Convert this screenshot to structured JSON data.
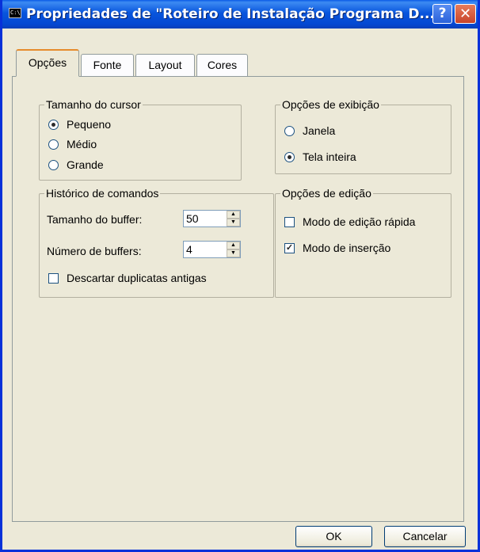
{
  "window": {
    "title": "Propriedades de \"Roteiro de Instalação Programa D...",
    "sysicon_text": "C:\\",
    "help_label": "?",
    "close_label": "✕"
  },
  "tabs": [
    {
      "label": "Opções",
      "active": true
    },
    {
      "label": "Fonte",
      "active": false
    },
    {
      "label": "Layout",
      "active": false
    },
    {
      "label": "Cores",
      "active": false
    }
  ],
  "cursor_size": {
    "legend": "Tamanho do cursor",
    "options": [
      {
        "label": "Pequeno",
        "selected": true
      },
      {
        "label": "Médio",
        "selected": false
      },
      {
        "label": "Grande",
        "selected": false
      }
    ]
  },
  "display_options": {
    "legend": "Opções de exibição",
    "options": [
      {
        "label": "Janela",
        "selected": false
      },
      {
        "label": "Tela inteira",
        "selected": true
      }
    ]
  },
  "command_history": {
    "legend": "Histórico de comandos",
    "buffer_size_label": "Tamanho do buffer:",
    "buffer_size_value": "50",
    "buffer_count_label": "Número de buffers:",
    "buffer_count_value": "4",
    "discard_label": "Descartar duplicatas antigas",
    "discard_checked": false
  },
  "edit_options": {
    "legend": "Opções de edição",
    "quick_edit_label": "Modo de edição rápida",
    "quick_edit_checked": false,
    "insert_label": "Modo de inserção",
    "insert_checked": true
  },
  "buttons": {
    "ok": "OK",
    "cancel": "Cancelar"
  }
}
